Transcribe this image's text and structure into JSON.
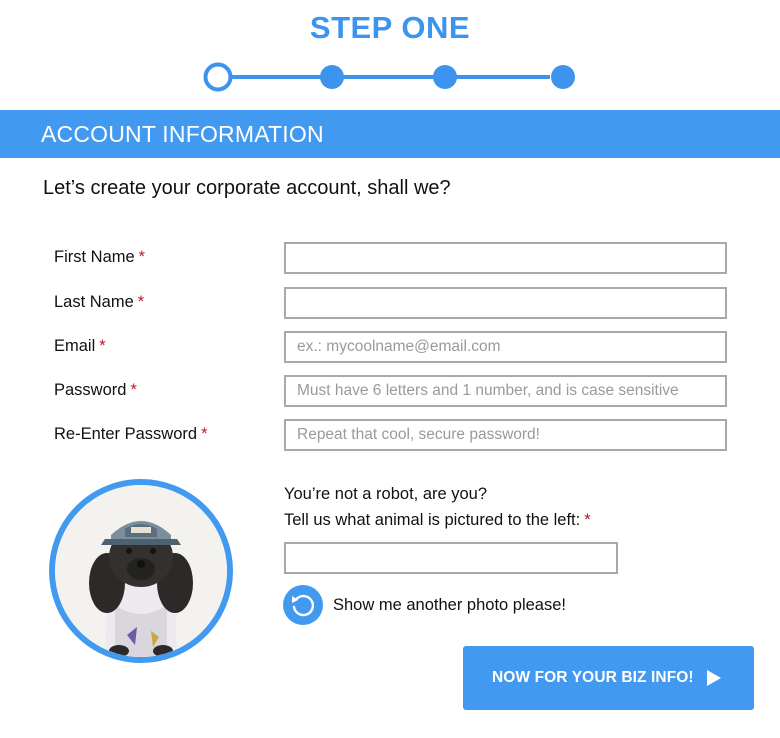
{
  "step_title": "STEP ONE",
  "progress": {
    "total_steps": 4,
    "current_step": 1,
    "accent": "#3d94ee"
  },
  "section": {
    "title": "ACCOUNT INFORMATION",
    "color": "#4199f0"
  },
  "intro_text": "Let’s create your corporate account, shall we?",
  "required_marker": "*",
  "required_color": "#c0162a",
  "fields": {
    "first_name": {
      "label": "First Name",
      "placeholder": "",
      "value": ""
    },
    "last_name": {
      "label": "Last Name",
      "placeholder": "",
      "value": ""
    },
    "email": {
      "label": "Email",
      "placeholder": "ex.: mycoolname@email.com",
      "value": ""
    },
    "password": {
      "label": "Password",
      "placeholder": "Must have 6 letters and 1 number, and is case sensitive",
      "value": ""
    },
    "password_confirm": {
      "label": "Re-Enter Password",
      "placeholder": "Repeat that cool, secure password!",
      "value": ""
    }
  },
  "captcha": {
    "photo_icon": "dog-photo",
    "question_line1": "You’re not a robot, are you?",
    "question_line2": "Tell us what animal is pictured to the left:",
    "answer": "",
    "refresh_icon": "refresh-icon",
    "refresh_label": "Show me another photo please!"
  },
  "next_button": {
    "label": "NOW FOR YOUR BIZ INFO!",
    "icon": "play-icon"
  }
}
